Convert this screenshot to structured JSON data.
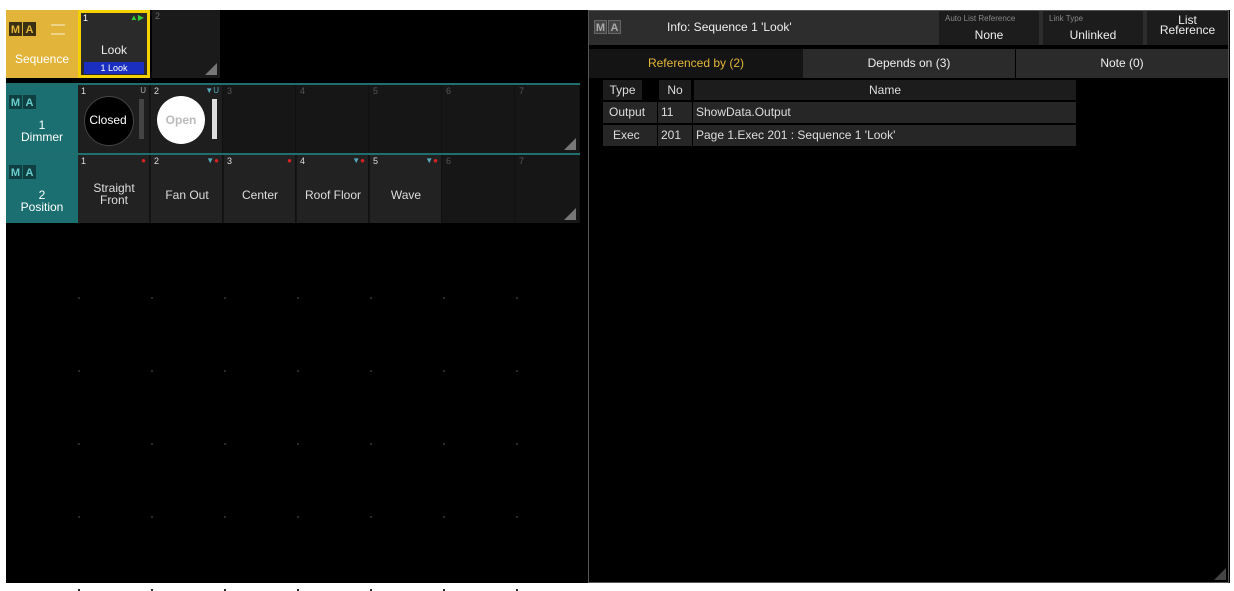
{
  "colors": {
    "accent": "#e2b53a",
    "teal": "#1c6f70",
    "select": "#f6d100"
  },
  "sequence_row": {
    "label": "Sequence",
    "cells": [
      {
        "num": "1",
        "title": "Look",
        "subtitle": "1 Look"
      },
      {
        "num": "2"
      }
    ]
  },
  "dimmer_row": {
    "number": "1",
    "label": "Dimmer",
    "cells": [
      {
        "num": "1",
        "title": "Closed"
      },
      {
        "num": "2",
        "title": "Open"
      },
      {
        "num": "3"
      },
      {
        "num": "4"
      },
      {
        "num": "5"
      },
      {
        "num": "6"
      },
      {
        "num": "7"
      }
    ]
  },
  "position_row": {
    "number": "2",
    "label": "Position",
    "cells": [
      {
        "num": "1",
        "title": "Straight Front"
      },
      {
        "num": "2",
        "title": "Fan Out"
      },
      {
        "num": "3",
        "title": "Center"
      },
      {
        "num": "4",
        "title": "Roof Floor"
      },
      {
        "num": "5",
        "title": "Wave"
      },
      {
        "num": "6"
      },
      {
        "num": "7"
      }
    ]
  },
  "info": {
    "title": "Info: Sequence 1 'Look'",
    "auto_list": {
      "label": "Auto List Reference",
      "value": "None"
    },
    "link_type": {
      "label": "Link Type",
      "value": "Unlinked"
    },
    "list_reference": {
      "line1": "List",
      "line2": "Reference"
    },
    "tabs": [
      "Referenced by (2)",
      "Depends on (3)",
      "Note (0)"
    ],
    "columns": [
      "Type",
      "No",
      "Name"
    ],
    "rows": [
      {
        "type": "Output",
        "no": "11",
        "name": "ShowData.Output"
      },
      {
        "type": "Exec",
        "no": "201",
        "name": "Page 1.Exec 201 : Sequence 1 'Look'"
      }
    ]
  },
  "logo": {
    "m": "M",
    "a": "A"
  }
}
